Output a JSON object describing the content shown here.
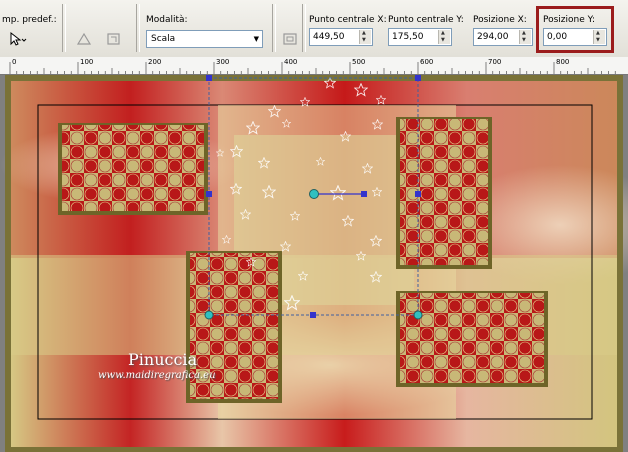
{
  "toolbar": {
    "preset_label": "mp. predef.:",
    "mode_label": "Modalità:",
    "mode_value": "Scala",
    "center_x_label": "Punto centrale X:",
    "center_x_value": "449,50",
    "center_y_label": "Punto centrale Y:",
    "center_y_value": "175,50",
    "pos_x_label": "Posizione X:",
    "pos_x_value": "294,00",
    "pos_y_label": "Posizione Y:",
    "pos_y_value": "0,00"
  },
  "ruler": {
    "ticks": [
      "0",
      "100",
      "200",
      "300",
      "400",
      "500",
      "600",
      "700",
      "800"
    ]
  },
  "watermark": {
    "name": "Pinuccia",
    "site": "www.maidiregrafica.eu"
  },
  "colors": {
    "highlight": "#9b1c1c",
    "canvas_red": "#c41a1a",
    "canvas_cream": "#d8cf8a",
    "handle": "#3333cc"
  }
}
